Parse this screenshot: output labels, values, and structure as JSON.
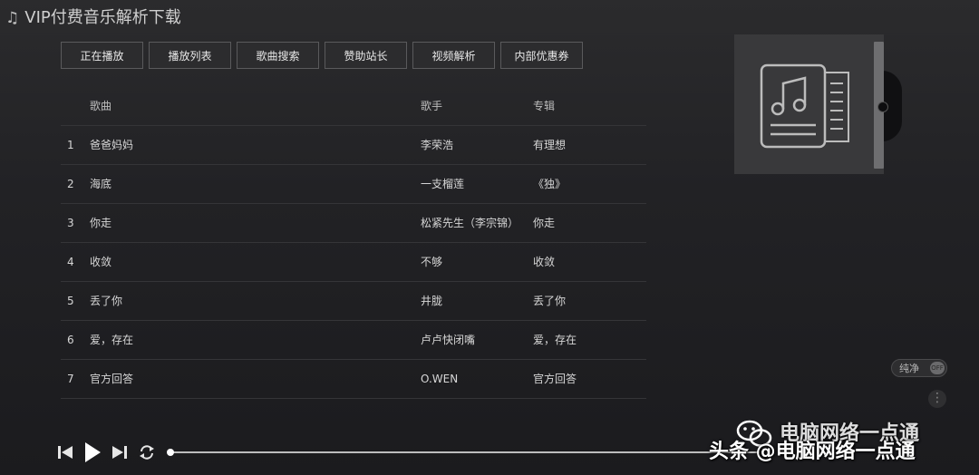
{
  "header": {
    "title": "VIP付费音乐解析下载"
  },
  "toolbar": {
    "buttons": [
      "正在播放",
      "播放列表",
      "歌曲搜索",
      "赞助站长",
      "视频解析",
      "内部优惠券"
    ]
  },
  "table": {
    "columns": {
      "song": "歌曲",
      "artist": "歌手",
      "album": "专辑"
    },
    "rows": [
      {
        "num": "1",
        "song": "爸爸妈妈",
        "artist": "李荣浩",
        "album": "有理想"
      },
      {
        "num": "2",
        "song": "海底",
        "artist": "一支榴莲",
        "album": "《独》"
      },
      {
        "num": "3",
        "song": "你走",
        "artist": "松紧先生（李宗锦）",
        "album": "你走"
      },
      {
        "num": "4",
        "song": "收敛",
        "artist": "不够",
        "album": "收敛"
      },
      {
        "num": "5",
        "song": "丢了你",
        "artist": "井胧",
        "album": "丢了你"
      },
      {
        "num": "6",
        "song": "爱，存在",
        "artist": "卢卢快闭嘴",
        "album": "爱，存在"
      },
      {
        "num": "7",
        "song": "官方回答",
        "artist": "O.WEN",
        "album": "官方回答"
      }
    ]
  },
  "side": {
    "toggle_label": "纯净",
    "toggle_state": "OFF",
    "more": "⋮"
  },
  "player": {
    "progress": 0.0
  },
  "watermark": {
    "line1": "电脑网络一点通",
    "line2": "头条 @电脑网络一点通"
  },
  "colors": {
    "background": "#222225",
    "button_border": "#5a5a5c",
    "progress": "#bdbdbd"
  }
}
